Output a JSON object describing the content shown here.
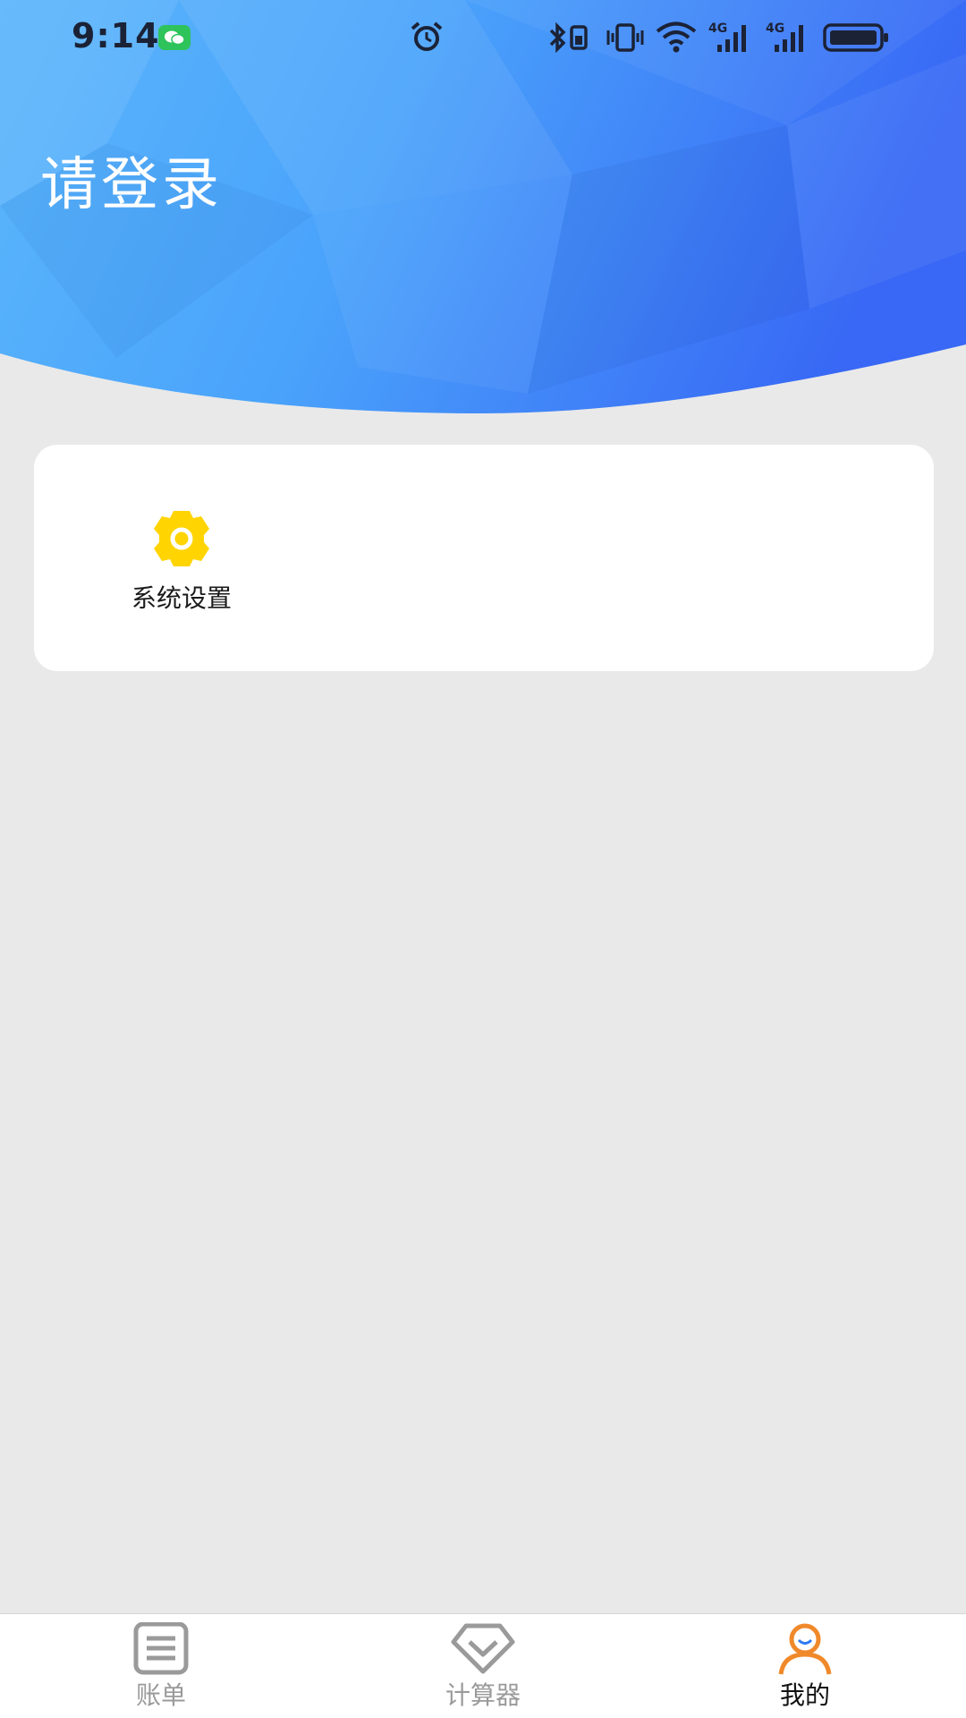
{
  "status_bar": {
    "time": "9:14",
    "network_1": "4G",
    "network_2": "4G"
  },
  "header": {
    "title": "请登录"
  },
  "card": {
    "items": [
      {
        "label": "系统设置",
        "icon": "gear-icon"
      }
    ]
  },
  "tabbar": {
    "tabs": [
      {
        "label": "账单",
        "icon": "bill-list-icon",
        "active": false
      },
      {
        "label": "计算器",
        "icon": "diamond-calculator-icon",
        "active": false
      },
      {
        "label": "我的",
        "icon": "user-icon",
        "active": true
      }
    ]
  },
  "colors": {
    "header_gradient_start": "#55b4fb",
    "header_gradient_end": "#3a6ff6",
    "gear": "#ffd400",
    "active_tab_icon": "#f0892a",
    "inactive_tab": "#9a9a9a",
    "page_background": "#e9e9e9"
  }
}
